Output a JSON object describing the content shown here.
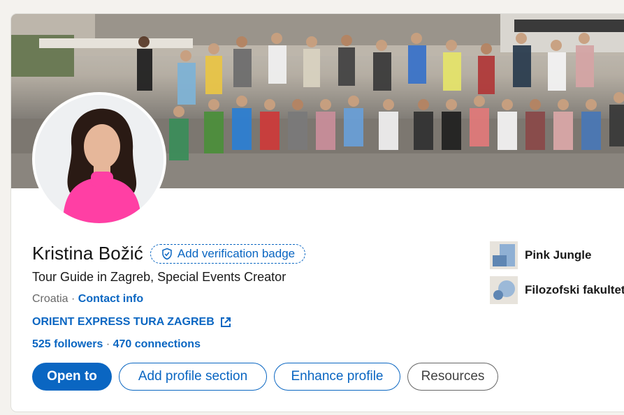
{
  "profile": {
    "name": "Kristina Božić",
    "verify_label": "Add verification badge",
    "headline": "Tour Guide in Zagreb, Special Events Creator",
    "location": "Croatia",
    "location_sep": " · ",
    "contact_label": "Contact info",
    "company_link": "ORIENT EXPRESS TURA ZAGREB",
    "followers": "525 followers",
    "stats_sep": " · ",
    "connections": "470 connections"
  },
  "actions": {
    "open_to": "Open to",
    "add_section": "Add profile section",
    "enhance": "Enhance profile",
    "resources": "Resources"
  },
  "side": {
    "items": [
      {
        "label": "Pink Jungle",
        "icon": "company-logo-icon"
      },
      {
        "label": "Filozofski fakultet",
        "icon": "school-logo-icon"
      }
    ]
  },
  "colors": {
    "brand_blue": "#0a66c2",
    "avatar_top": "#e8372f",
    "card_bg": "#ffffff",
    "page_bg": "#f4f2ee"
  }
}
